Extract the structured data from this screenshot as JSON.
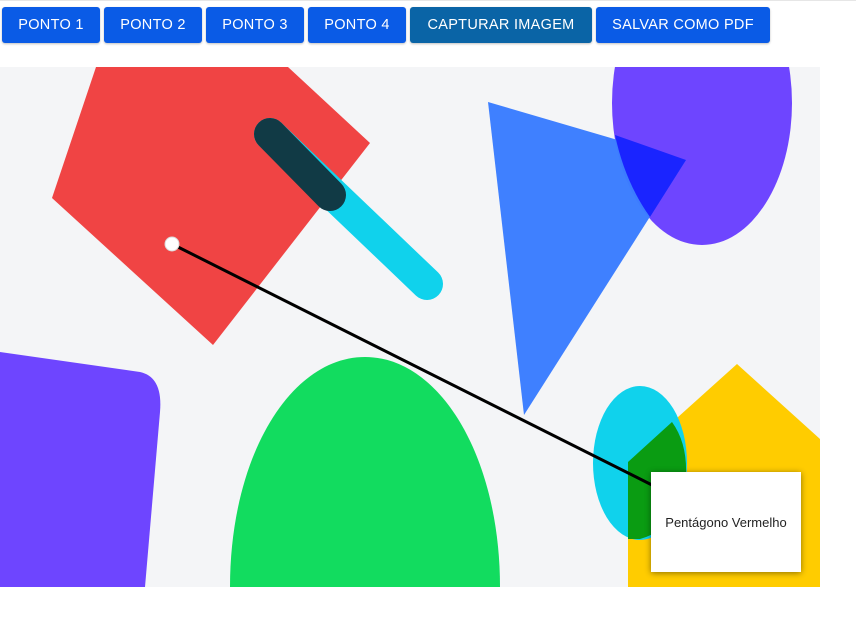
{
  "toolbar": {
    "buttons": [
      {
        "label": "PONTO 1"
      },
      {
        "label": "PONTO 2"
      },
      {
        "label": "PONTO 3"
      },
      {
        "label": "PONTO 4"
      },
      {
        "label": "CAPTURAR IMAGEM"
      },
      {
        "label": "SALVAR COMO PDF"
      }
    ]
  },
  "canvas": {
    "shapes": [
      {
        "kind": "pentagon",
        "color": "#f04444"
      },
      {
        "kind": "capsule",
        "color": "#10d2ec"
      },
      {
        "kind": "triangle",
        "color": "#3b7dff"
      },
      {
        "kind": "ellipse",
        "color": "#6e45ff"
      },
      {
        "kind": "rounded-polygon",
        "color": "#6e45ff"
      },
      {
        "kind": "semi-ellipse",
        "color": "#12dc5f"
      },
      {
        "kind": "house-pentagon",
        "color": "#ffcc00"
      },
      {
        "kind": "ellipse",
        "color": "#10d2ec"
      }
    ],
    "pointer_line_color": "#000000"
  },
  "tooltip": {
    "text": "Pentágono Vermelho"
  }
}
